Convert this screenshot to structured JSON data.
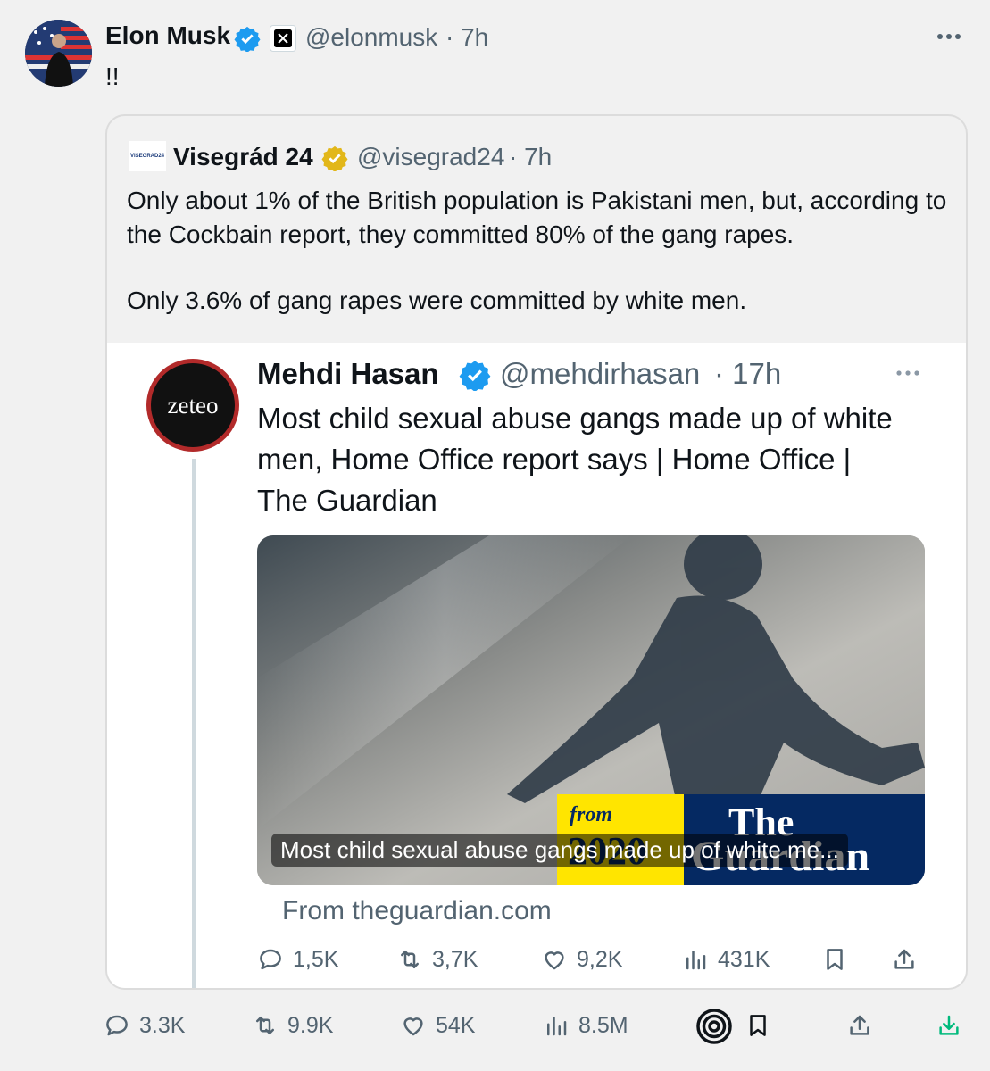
{
  "tweet": {
    "author_name": "Elon Musk",
    "handle": "@elonmusk",
    "time": "· 7h",
    "text": "!!",
    "affiliate_icon": "x-logo-icon",
    "more_icon": "more-icon"
  },
  "quote": {
    "avatar_text": "VISEGRAD24",
    "author_name": "Visegrád 24",
    "handle": "@visegrad24",
    "time": "· 7h",
    "paragraph1": "Only about 1% of the British population is Pakistani men, but, according to the Cockbain report, they committed 80% of the gang rapes.",
    "paragraph2": "Only 3.6% of gang rapes were committed by white men."
  },
  "embedded": {
    "avatar_text": "zeteo",
    "author_name": "Mehdi Hasan",
    "handle": "@mehdirhasan",
    "time": "· 17h",
    "headline": "Most child sexual abuse gangs made up of white men, Home Office report says | Home Office | The Guardian",
    "card": {
      "overlay_caption": "Most child sexual abuse gangs made up of white me...",
      "from_label": "from",
      "year_label": "2020",
      "brand_the": "The",
      "brand_guardian": "Guardian",
      "source": "From theguardian.com"
    },
    "actions": {
      "replies": "1,5K",
      "reposts": "3,7K",
      "likes": "9,2K",
      "views": "431K"
    }
  },
  "actions": {
    "replies": "3.3K",
    "reposts": "9.9K",
    "likes": "54K",
    "views": "8.5M"
  },
  "colors": {
    "verified_blue": "#1d9bf0",
    "verified_gold": "#e2b719",
    "guardian_navy": "#052962",
    "guardian_yellow": "#ffe500",
    "download_green": "#00ba7c"
  }
}
